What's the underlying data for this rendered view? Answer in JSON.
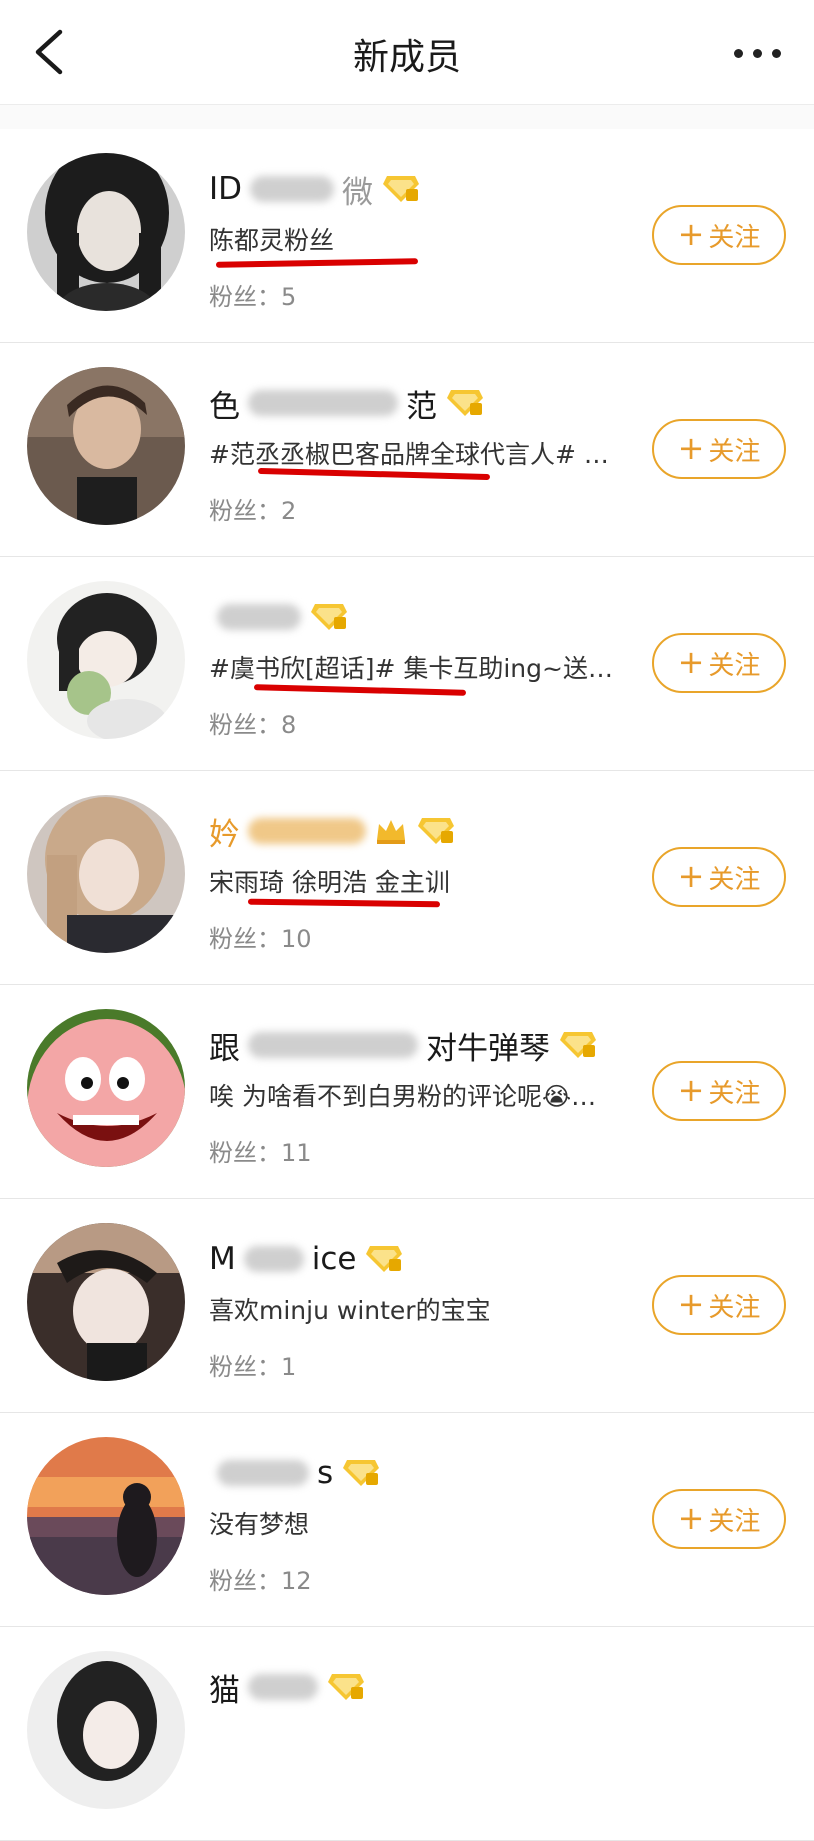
{
  "header": {
    "title": "新成员"
  },
  "colors": {
    "accent": "#e79a2b",
    "annotation_underline": "#d90000"
  },
  "follow_label": "关注",
  "follow_icon": "plus-icon",
  "members": [
    {
      "name": "ID",
      "blurred": true,
      "name_tail": "微",
      "desc": "陈都灵粉丝",
      "fans": "粉丝：5",
      "avatar": "avatar-photo-dark-hair",
      "badge": "diamond-badge-icon"
    },
    {
      "name": "色",
      "blurred": true,
      "name_tail": "范",
      "desc": "#范丞丞椒巴客品牌全球代言人# …",
      "fans": "粉丝：2",
      "avatar": "avatar-photo-male",
      "badge": "diamond-badge-icon"
    },
    {
      "name": "",
      "blurred": true,
      "name_tail": "",
      "desc": "#虞书欣[超话]# 集卡互助ing~送…",
      "fans": "粉丝：8",
      "avatar": "avatar-illustration-girl",
      "badge": "diamond-badge-icon"
    },
    {
      "name": "妗",
      "blurred": true,
      "name_tail": "",
      "desc": "宋雨琦 徐明浩 金主训",
      "fans": "粉丝：10",
      "avatar": "avatar-photo-blonde",
      "badge": "diamond-badge-icon",
      "crown": "crown-icon",
      "gold": true
    },
    {
      "name": "跟",
      "blurred": true,
      "name_tail": "对牛弹琴",
      "desc": "唉 为啥看不到白男粉的评论呢😭…",
      "fans": "粉丝：11",
      "avatar": "avatar-cartoon-patrick",
      "badge": "diamond-badge-icon"
    },
    {
      "name": "M",
      "blurred": true,
      "name_tail": "ice",
      "desc": "喜欢minju winter的宝宝",
      "fans": "粉丝：1",
      "avatar": "avatar-photo-selfie",
      "badge": "diamond-badge-icon"
    },
    {
      "name": "",
      "blurred": true,
      "name_tail": "s",
      "desc": "没有梦想",
      "fans": "粉丝：12",
      "avatar": "avatar-photo-sunset",
      "badge": "diamond-badge-icon"
    },
    {
      "name": "猫",
      "blurred": true,
      "name_tail": "",
      "desc": "",
      "fans": "",
      "avatar": "avatar-photo-girl",
      "badge": "diamond-badge-icon"
    }
  ]
}
